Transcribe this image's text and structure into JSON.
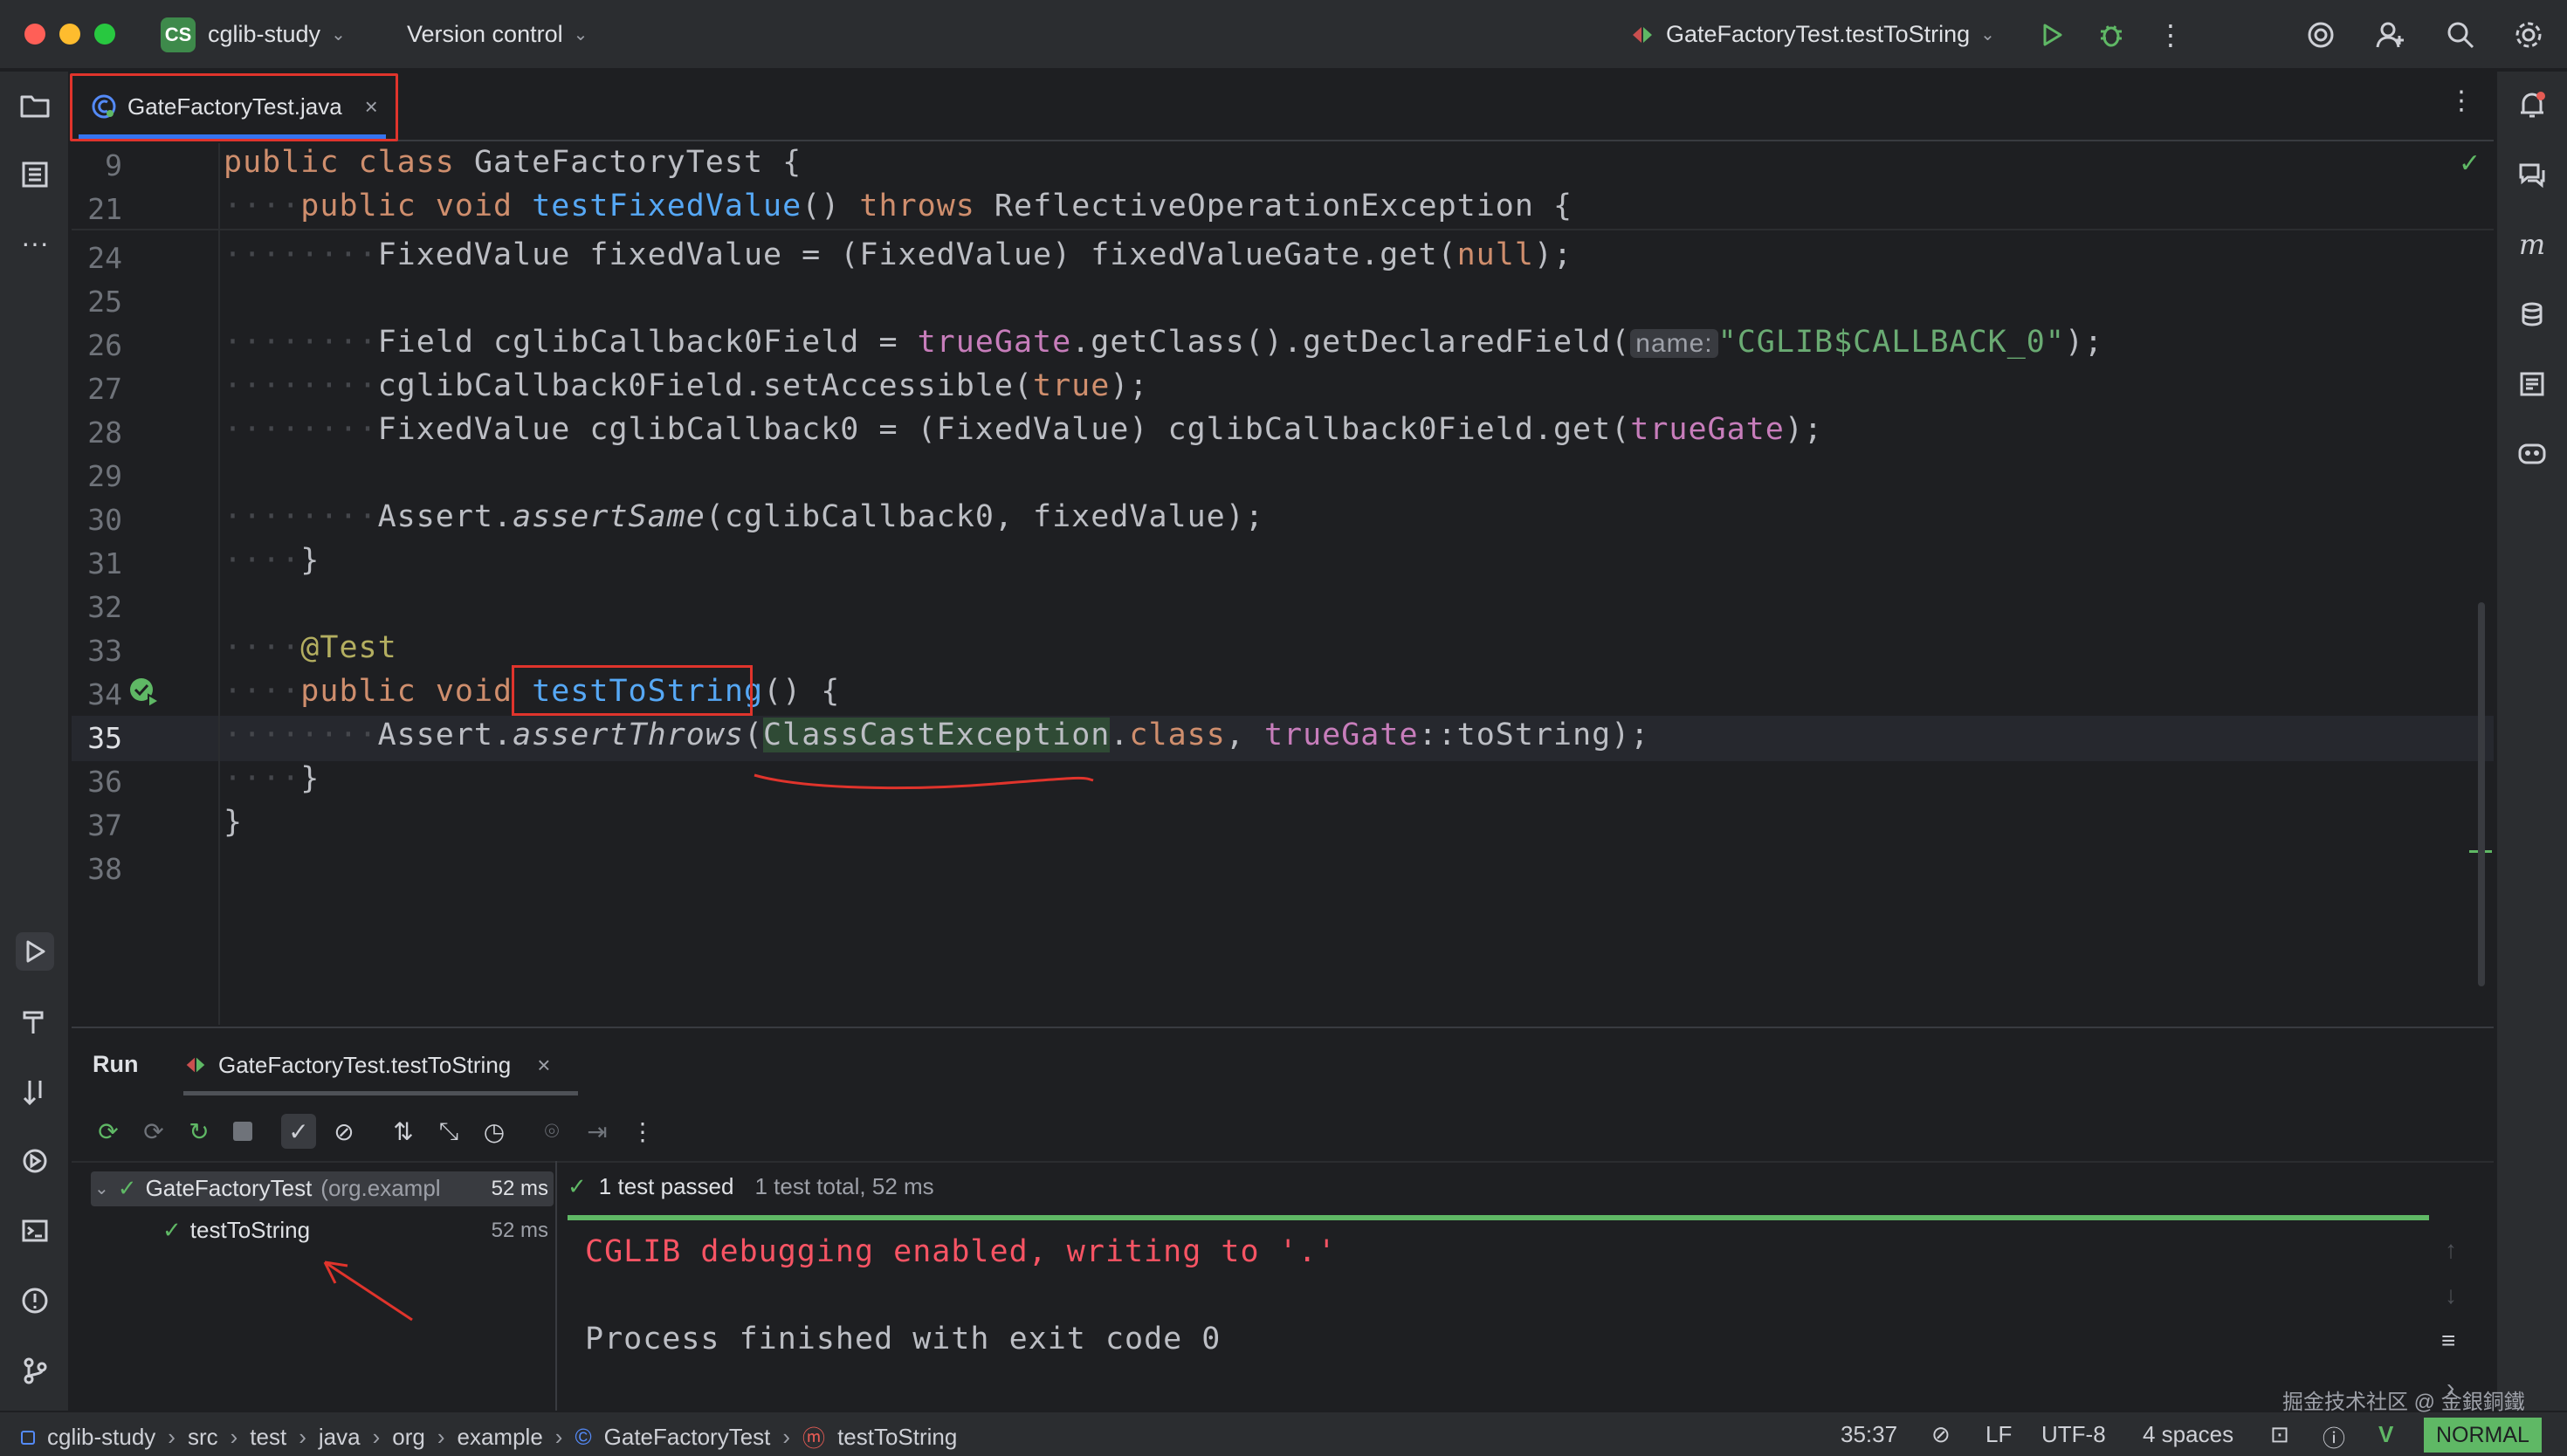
{
  "titlebar": {
    "project_badge": "CS",
    "project_name": "cglib-study",
    "version_control": "Version control",
    "run_config": "GateFactoryTest.testToString"
  },
  "editor_tab": {
    "label": "GateFactoryTest.java",
    "close": "×"
  },
  "code_lines": [
    {
      "n": "9"
    },
    {
      "n": "21"
    },
    {
      "n": "24"
    },
    {
      "n": "25"
    },
    {
      "n": "26"
    },
    {
      "n": "27"
    },
    {
      "n": "28"
    },
    {
      "n": "29"
    },
    {
      "n": "30"
    },
    {
      "n": "31"
    },
    {
      "n": "32"
    },
    {
      "n": "33"
    },
    {
      "n": "34"
    },
    {
      "n": "35"
    },
    {
      "n": "36"
    },
    {
      "n": "37"
    },
    {
      "n": "38"
    }
  ],
  "code": {
    "l9": [
      "public",
      " ",
      "class",
      " GateFactoryTest {"
    ],
    "l21": [
      "public",
      " ",
      "void",
      " ",
      "testFixedValue",
      "() ",
      "throws",
      " ReflectiveOperationException {"
    ],
    "l24": [
      "FixedValue fixedValue = (FixedValue) fixedValueGate.get(",
      "null",
      ");"
    ],
    "l26": [
      "Field cglibCallback0Field = ",
      "trueGate",
      ".getClass().getDeclaredField(",
      "name:",
      "\"CGLIB$CALLBACK_0\"",
      ");"
    ],
    "l27": [
      "cglibCallback0Field.setAccessible(",
      "true",
      ");"
    ],
    "l28": [
      "FixedValue cglibCallback0 = (FixedValue) cglibCallback0Field.get(",
      "trueGate",
      ");"
    ],
    "l30": [
      "Assert.",
      "assertSame",
      "(cglibCallback0, fixedValue);"
    ],
    "l31": "}",
    "l33": "@Test",
    "l34": [
      "public",
      " ",
      "void",
      " ",
      "testToString",
      "() {"
    ],
    "l35": [
      "Assert.",
      "assertThrows",
      "(",
      "ClassCastException",
      ".",
      "class",
      ", ",
      "trueGate",
      "::toString);"
    ],
    "l36": "}",
    "l37": "}"
  },
  "run_panel": {
    "title": "Run",
    "tab_label": "GateFactoryTest.testToString",
    "tab_close": "×",
    "tree": {
      "root_name": "GateFactoryTest",
      "root_pkg": "(org.exampl",
      "root_time": "52 ms",
      "child_name": "testToString",
      "child_time": "52 ms"
    },
    "summary_passed": "1 test passed",
    "summary_total": "1 test total, 52 ms",
    "console_lines": [
      "CGLIB debugging enabled, writing to '.'",
      "Process finished with exit code 0"
    ]
  },
  "statusbar": {
    "breadcrumbs": [
      "cglib-study",
      "src",
      "test",
      "java",
      "org",
      "example",
      "GateFactoryTest",
      "testToString"
    ],
    "position": "35:37",
    "line_sep": "LF",
    "encoding": "UTF-8",
    "indent": "4 spaces",
    "mode": "NORMAL",
    "watermark": "掘金技术社区 @ 金銀銅鐵"
  },
  "colors": {
    "accent": "#3574f0",
    "pass": "#5fb865",
    "annotation_red": "#e0342c",
    "mode_badge": "#5fb865"
  }
}
